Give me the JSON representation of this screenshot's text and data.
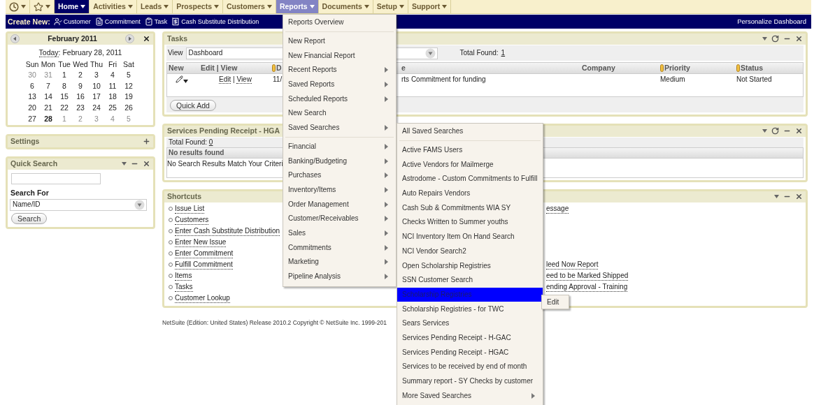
{
  "topnav": {
    "tabs": [
      {
        "kind": "recent",
        "selected": false,
        "open": false
      },
      {
        "kind": "star",
        "selected": false,
        "open": false
      },
      {
        "kind": "text",
        "label": "Home",
        "selected": true,
        "open": false
      },
      {
        "kind": "text",
        "label": "Activities",
        "selected": false,
        "open": false
      },
      {
        "kind": "text",
        "label": "Leads",
        "selected": false,
        "open": false
      },
      {
        "kind": "text",
        "label": "Prospects",
        "selected": false,
        "open": false
      },
      {
        "kind": "text",
        "label": "Customers",
        "selected": false,
        "open": false
      },
      {
        "kind": "text",
        "label": "Reports",
        "selected": false,
        "open": true
      },
      {
        "kind": "text",
        "label": "Documents",
        "selected": false,
        "open": false
      },
      {
        "kind": "text",
        "label": "Setup",
        "selected": false,
        "open": false
      },
      {
        "kind": "text",
        "label": "Support",
        "selected": false,
        "open": false
      }
    ]
  },
  "create_new": {
    "label": "Create New:",
    "items": [
      {
        "kind": "person",
        "label": "Customer"
      },
      {
        "kind": "document",
        "label": "Commitment"
      },
      {
        "kind": "clipboard",
        "label": "Task"
      },
      {
        "kind": "receipt",
        "label": "Cash Substitute Distribution"
      }
    ],
    "personalize": "Personalize Dashboard"
  },
  "calendar": {
    "title": "February 2011",
    "today_link": "Today",
    "today_text": ": February 28, 2011",
    "weekdays": [
      "Sun",
      "Mon",
      "Tue",
      "Wed",
      "Thu",
      "Fri",
      "Sat"
    ],
    "weeks": [
      [
        {
          "day": "30",
          "muted": true,
          "selected": false
        },
        {
          "day": "31",
          "muted": true,
          "selected": false
        },
        {
          "day": "1",
          "muted": false,
          "selected": false
        },
        {
          "day": "2",
          "muted": false,
          "selected": false
        },
        {
          "day": "3",
          "muted": false,
          "selected": false
        },
        {
          "day": "4",
          "muted": false,
          "selected": false
        },
        {
          "day": "5",
          "muted": false,
          "selected": false
        }
      ],
      [
        {
          "day": "6",
          "muted": false,
          "selected": false
        },
        {
          "day": "7",
          "muted": false,
          "selected": false
        },
        {
          "day": "8",
          "muted": false,
          "selected": false
        },
        {
          "day": "9",
          "muted": false,
          "selected": false
        },
        {
          "day": "10",
          "muted": false,
          "selected": false
        },
        {
          "day": "11",
          "muted": false,
          "selected": false
        },
        {
          "day": "12",
          "muted": false,
          "selected": false
        }
      ],
      [
        {
          "day": "13",
          "muted": false,
          "selected": false
        },
        {
          "day": "14",
          "muted": false,
          "selected": false
        },
        {
          "day": "15",
          "muted": false,
          "selected": false
        },
        {
          "day": "16",
          "muted": false,
          "selected": false
        },
        {
          "day": "17",
          "muted": false,
          "selected": false
        },
        {
          "day": "18",
          "muted": false,
          "selected": false
        },
        {
          "day": "19",
          "muted": false,
          "selected": false
        }
      ],
      [
        {
          "day": "20",
          "muted": false,
          "selected": false
        },
        {
          "day": "21",
          "muted": false,
          "selected": false
        },
        {
          "day": "22",
          "muted": false,
          "selected": false
        },
        {
          "day": "23",
          "muted": false,
          "selected": false
        },
        {
          "day": "24",
          "muted": false,
          "selected": false
        },
        {
          "day": "25",
          "muted": false,
          "selected": false
        },
        {
          "day": "26",
          "muted": false,
          "selected": false
        }
      ],
      [
        {
          "day": "27",
          "muted": false,
          "selected": false
        },
        {
          "day": "28",
          "muted": false,
          "selected": true
        },
        {
          "day": "1",
          "muted": true,
          "selected": false
        },
        {
          "day": "2",
          "muted": true,
          "selected": false
        },
        {
          "day": "3",
          "muted": true,
          "selected": false
        },
        {
          "day": "4",
          "muted": true,
          "selected": false
        },
        {
          "day": "5",
          "muted": true,
          "selected": false
        }
      ]
    ]
  },
  "settings": {
    "title": "Settings",
    "controls": [
      {
        "kind": "add"
      }
    ]
  },
  "quick_search": {
    "title": "Quick Search",
    "controls": [
      {
        "kind": "menu"
      },
      {
        "kind": "minimize"
      },
      {
        "kind": "close"
      }
    ],
    "search_for_label": "Search For",
    "select_value": "Name/ID",
    "button": "Search"
  },
  "tasks": {
    "title": "Tasks",
    "controls": [
      {
        "kind": "menu"
      },
      {
        "kind": "refresh"
      },
      {
        "kind": "minimize"
      },
      {
        "kind": "close"
      }
    ],
    "view_label": "View",
    "view_value": "Dashboard",
    "total_label": "Total Found:",
    "total_value": "1",
    "columns": [
      {
        "label": "New",
        "marker": false
      },
      {
        "label": "Edit | View",
        "marker": false
      },
      {
        "label": "D",
        "marker": true
      },
      {
        "label": "e",
        "marker": false
      },
      {
        "label": "Company",
        "marker": false
      },
      {
        "label": "Priority",
        "marker": true
      },
      {
        "label": "Status",
        "marker": true
      }
    ],
    "rows": [
      {
        "edit": "Edit",
        "divider": "|",
        "view": "View",
        "date": "11/",
        "title": "rts Commitment for funding",
        "priority": "Medium",
        "status": "Not Started"
      }
    ],
    "quick_add": "Quick Add"
  },
  "services": {
    "title": "Services Pending Receipt - HGA",
    "controls": [
      {
        "kind": "menu"
      },
      {
        "kind": "refresh"
      },
      {
        "kind": "minimize"
      },
      {
        "kind": "close"
      }
    ],
    "total_label": "Total Found:",
    "total_value": "0",
    "header": "No results found",
    "message": "No Search Results Match Your Criteri"
  },
  "shortcuts": {
    "title": "Shortcuts",
    "controls": [
      {
        "kind": "menu"
      },
      {
        "kind": "minimize"
      },
      {
        "kind": "close"
      }
    ],
    "rows": [
      {
        "left": "Issue List",
        "right": "essage"
      },
      {
        "left": "Customers"
      },
      {
        "left": "Enter Cash Substitute Distribution"
      },
      {
        "left": "Enter New Issue"
      },
      {
        "left": "Enter Commitment"
      },
      {
        "left": "Fulfill Commitment",
        "right": "leed Now Report"
      },
      {
        "left": "Items",
        "right": "eed to be Marked Shipped"
      },
      {
        "left": "Tasks",
        "right": "ending Approval - Training"
      },
      {
        "left": "Customer Lookup"
      }
    ]
  },
  "footer": "NetSuite (Edition: United States) Release 2010.2 Copyright © NetSuite Inc. 1999-201",
  "reports_menu": {
    "items": [
      {
        "kind": "item",
        "label": "Reports Overview",
        "submenu": false
      },
      {
        "kind": "separator"
      },
      {
        "kind": "item",
        "label": "New Report",
        "submenu": false
      },
      {
        "kind": "item",
        "label": "New Financial Report",
        "submenu": false
      },
      {
        "kind": "item",
        "label": "Recent Reports",
        "submenu": true
      },
      {
        "kind": "item",
        "label": "Saved Reports",
        "submenu": true
      },
      {
        "kind": "item",
        "label": "Scheduled Reports",
        "submenu": true
      },
      {
        "kind": "item",
        "label": "New Search",
        "submenu": false
      },
      {
        "kind": "item",
        "label": "Saved Searches",
        "submenu": true
      },
      {
        "kind": "separator"
      },
      {
        "kind": "item",
        "label": "Financial",
        "submenu": true
      },
      {
        "kind": "item",
        "label": "Banking/Budgeting",
        "submenu": true
      },
      {
        "kind": "item",
        "label": "Purchases",
        "submenu": true
      },
      {
        "kind": "item",
        "label": "Inventory/Items",
        "submenu": true
      },
      {
        "kind": "item",
        "label": "Order Management",
        "submenu": true
      },
      {
        "kind": "item",
        "label": "Customer/Receivables",
        "submenu": true
      },
      {
        "kind": "item",
        "label": "Sales",
        "submenu": true
      },
      {
        "kind": "item",
        "label": "Commitments",
        "submenu": true
      },
      {
        "kind": "item",
        "label": "Marketing",
        "submenu": true
      },
      {
        "kind": "item",
        "label": "Pipeline Analysis",
        "submenu": true
      }
    ]
  },
  "saved_searches_menu": {
    "items": [
      {
        "kind": "item",
        "label": "All Saved Searches",
        "submenu": false,
        "selected": false
      },
      {
        "kind": "separator"
      },
      {
        "kind": "item",
        "label": "Active FAMS Users",
        "submenu": false,
        "selected": false
      },
      {
        "kind": "item",
        "label": "Active Vendors for Mailmerge",
        "submenu": false,
        "selected": false
      },
      {
        "kind": "item",
        "label": "Astrodome - Custom Commitments to Fulfill",
        "submenu": false,
        "selected": false
      },
      {
        "kind": "item",
        "label": "Auto Repairs Vendors",
        "submenu": false,
        "selected": false
      },
      {
        "kind": "item",
        "label": "Cash Sub & Commitments WIA SY",
        "submenu": false,
        "selected": false
      },
      {
        "kind": "item",
        "label": "Checks Written to Summer youths",
        "submenu": false,
        "selected": false
      },
      {
        "kind": "item",
        "label": "NCI Inventory Item On Hand Search",
        "submenu": false,
        "selected": false
      },
      {
        "kind": "item",
        "label": "NCI Vendor Search2",
        "submenu": false,
        "selected": false
      },
      {
        "kind": "item",
        "label": "Open Scholarship Registries",
        "submenu": false,
        "selected": false
      },
      {
        "kind": "item",
        "label": "SSN Customer Search",
        "submenu": false,
        "selected": false
      },
      {
        "kind": "item",
        "label": "Scholarship Registries",
        "submenu": false,
        "selected": true
      },
      {
        "kind": "item",
        "label": "Scholarship Registries - for TWC",
        "submenu": false,
        "selected": false
      },
      {
        "kind": "item",
        "label": "Sears Services",
        "submenu": false,
        "selected": false
      },
      {
        "kind": "item",
        "label": "Services Pending Receipt - H-GAC",
        "submenu": false,
        "selected": false
      },
      {
        "kind": "item",
        "label": "Services Pending Receipt - HGAC",
        "submenu": false,
        "selected": false
      },
      {
        "kind": "item",
        "label": "Services to be received by end of month",
        "submenu": false,
        "selected": false
      },
      {
        "kind": "item",
        "label": "Summary report - SY Checks by customer",
        "submenu": false,
        "selected": false
      },
      {
        "kind": "item",
        "label": "More Saved Searches",
        "submenu": true,
        "selected": false
      }
    ]
  },
  "edit_popup": {
    "label": "Edit"
  }
}
